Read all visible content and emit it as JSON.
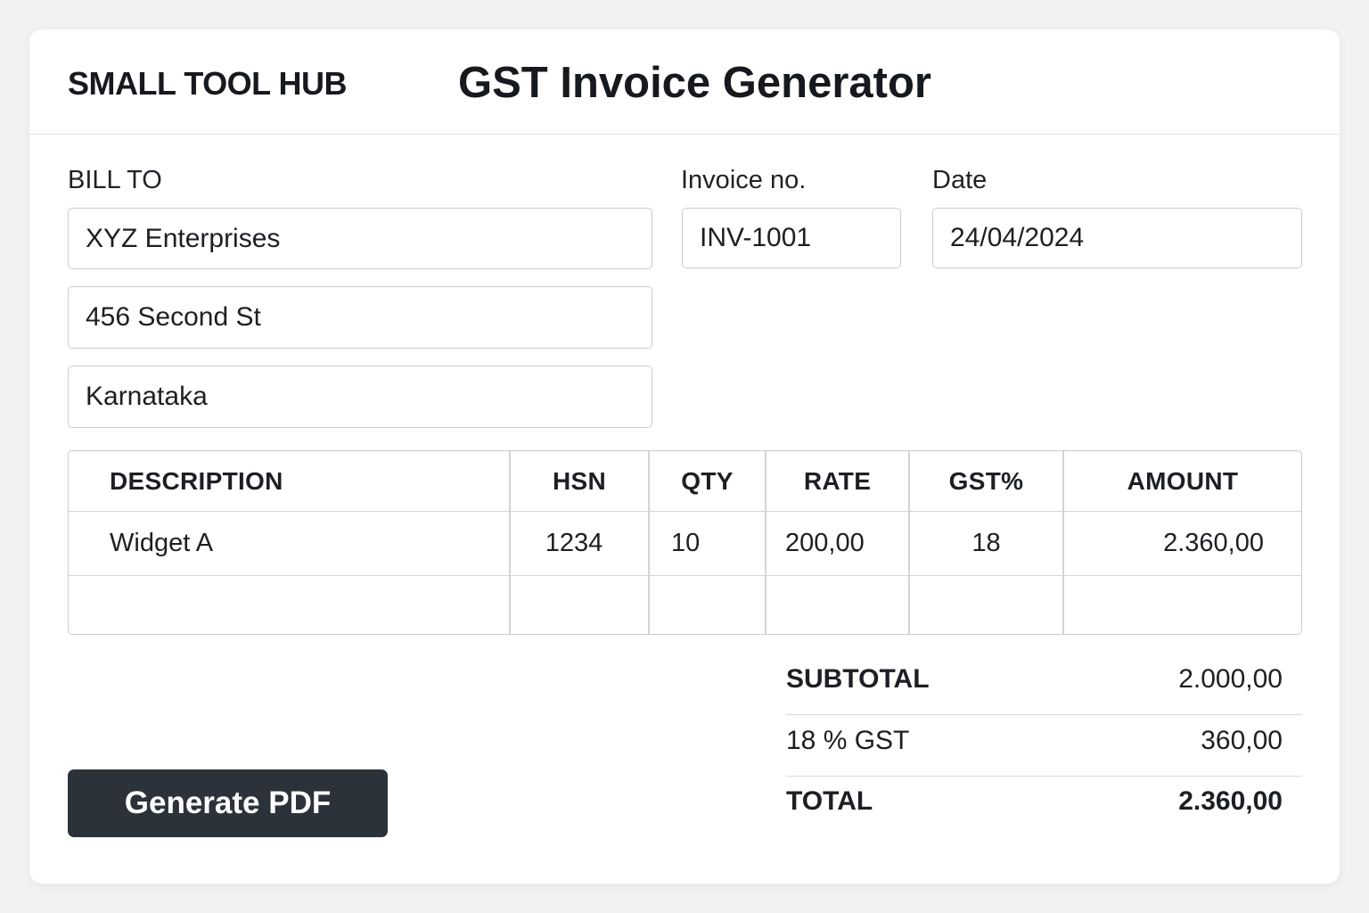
{
  "header": {
    "brand": "SMALL TOOL HUB",
    "title": "GST Invoice Generator"
  },
  "bill_to": {
    "label": "BILL TO",
    "name": "XYZ Enterprises",
    "address": "456 Second St",
    "state": "Karnataka"
  },
  "invoice": {
    "number_label": "Invoice no.",
    "number": "INV-1001",
    "date_label": "Date",
    "date": "24/04/2024"
  },
  "table": {
    "columns": [
      "DESCRIPTION",
      "HSN",
      "QTY",
      "RATE",
      "GST%",
      "AMOUNT"
    ],
    "rows": [
      [
        "Widget A",
        "1234",
        "10",
        "200,00",
        "18",
        "2.360,00"
      ],
      [
        "",
        "",
        "",
        "",
        "",
        ""
      ]
    ]
  },
  "totals": {
    "subtotal_label": "SUBTOTAL",
    "subtotal": "2.000,00",
    "gst_label": "18 % GST",
    "gst": "360,00",
    "total_label": "TOTAL",
    "total": "2.360,00"
  },
  "actions": {
    "generate_label": "Generate PDF"
  }
}
